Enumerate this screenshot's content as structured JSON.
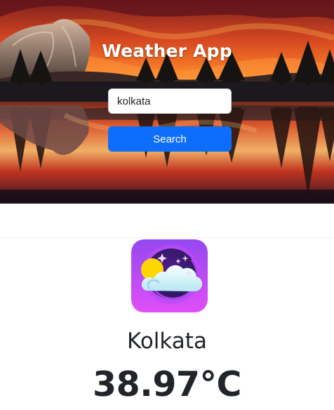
{
  "header": {
    "title": "Weather App"
  },
  "search": {
    "value": "kolkata",
    "button_label": "Search"
  },
  "weather": {
    "city": "Kolkata",
    "temperature": "38.97°C",
    "icon": "weather-icon"
  },
  "colors": {
    "button": "#0d6efd",
    "text": "#212529",
    "icon_bg": "#c448f5",
    "sun": "#ffd600"
  }
}
